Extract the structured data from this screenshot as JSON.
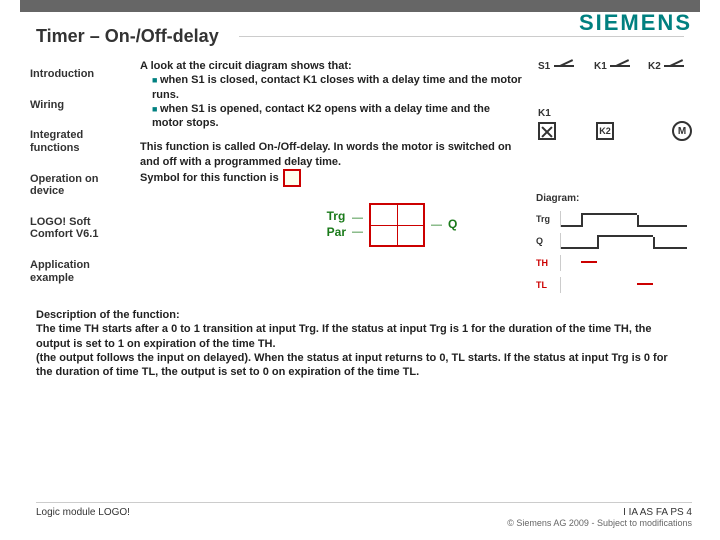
{
  "brand": "SIEMENS",
  "title": "Timer – On-/Off-delay",
  "sidebar": {
    "items": [
      {
        "label": "Introduction"
      },
      {
        "label": "Wiring"
      },
      {
        "label": "Integrated functions"
      },
      {
        "label": "Operation on device"
      },
      {
        "label": "LOGO! Soft Comfort V6.1"
      },
      {
        "label": "Application example"
      }
    ]
  },
  "body": {
    "intro": "A look at the circuit diagram shows that:",
    "bul1": "when S1 is closed, contact K1 closes with a delay time and the motor runs.",
    "bul2": "when S1 is opened, contact K2 opens with a delay time and the motor stops.",
    "p2a": "This function is called On-/Off-delay. In words the motor is switched on and off with a programmed delay time.",
    "p2b": "Symbol for this function is"
  },
  "block": {
    "trg": "Trg",
    "par": "Par",
    "q": "Q"
  },
  "circuit": {
    "s1": "S1",
    "k1": "K1",
    "k2": "K2",
    "m": "M",
    "diag_label": "Diagram:",
    "rows": {
      "trg": "Trg",
      "q": "Q",
      "th": "TH",
      "tl": "TL"
    }
  },
  "description": {
    "head": "Description of the function:",
    "p1": "The time TH starts after a 0 to 1 transition at input Trg. If the status at input Trg is 1 for the duration of the time TH, the output is set to 1 on expiration of the time TH.",
    "p2": "(the output follows the input on delayed). When the status at input returns to 0, TL starts. If the status at input Trg is 0 for the duration of time TL, the output is set to 0 on expiration of the time TL."
  },
  "footer": {
    "left": "Logic module LOGO!",
    "right_top": "I IA AS FA PS 4",
    "right_bot": "© Siemens AG 2009 - Subject to modifications"
  }
}
